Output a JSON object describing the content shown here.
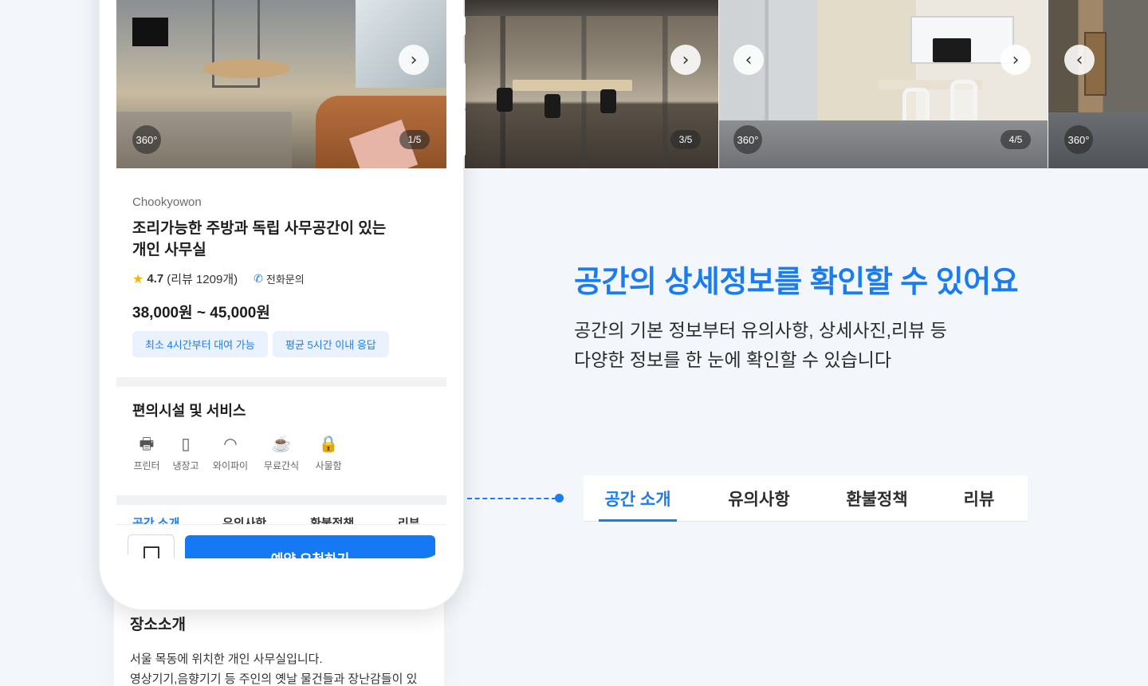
{
  "phone_card": {
    "hero": {
      "badge_360": "360°",
      "counter": "1/5"
    },
    "host": "Chookyowon",
    "title": "조리가능한 주방과 독립  사무공간이 있는 개인 사무실",
    "rating": "4.7",
    "review_count": "(리뷰 1209개)",
    "contact_label": "전화문의",
    "price": "38,000원 ~  45,000원",
    "chips": [
      "최소 4시간부터 대여 가능",
      "평균 5시간 이내 응답"
    ],
    "facilities": {
      "title": "편의시설 및 서비스",
      "items": [
        {
          "icon": "printer-icon",
          "label": "프린터"
        },
        {
          "icon": "fridge-icon",
          "label": "냉장고"
        },
        {
          "icon": "wifi-icon",
          "label": "와이파이"
        },
        {
          "icon": "cup-icon",
          "label": "무료간식"
        },
        {
          "icon": "lock-icon",
          "label": "사물함"
        }
      ]
    },
    "tabs": [
      "공간 소개",
      "유의사항",
      "환불정책",
      "리뷰"
    ],
    "reserve_label": "예약 요청하기"
  },
  "below_card": {
    "section_title": "장소소개",
    "body_lines": [
      "서울 목동에 위치한 개인 사무실입니다.",
      "영상기기,음향기기 등 주인의 옛날 물건들과 장난감들이 있"
    ]
  },
  "photos": [
    {
      "counter": "3/5"
    },
    {
      "badge_360": "360°",
      "counter": "4/5"
    },
    {
      "badge_360": "360°"
    }
  ],
  "headline": "공간의 상세정보를 확인할 수 있어요",
  "subcopy": [
    "공간의 기본 정보부터 유의사항,  상세사진,리뷰 등",
    "다양한 정보를  한  눈에 확인할 수 있습니다"
  ],
  "tabbar": [
    "공간 소개",
    "유의사항",
    "환불정책",
    "리뷰"
  ],
  "colors": {
    "accent": "#1b7cf2",
    "chip_bg": "#e9f2fe",
    "star": "#f5b800"
  }
}
